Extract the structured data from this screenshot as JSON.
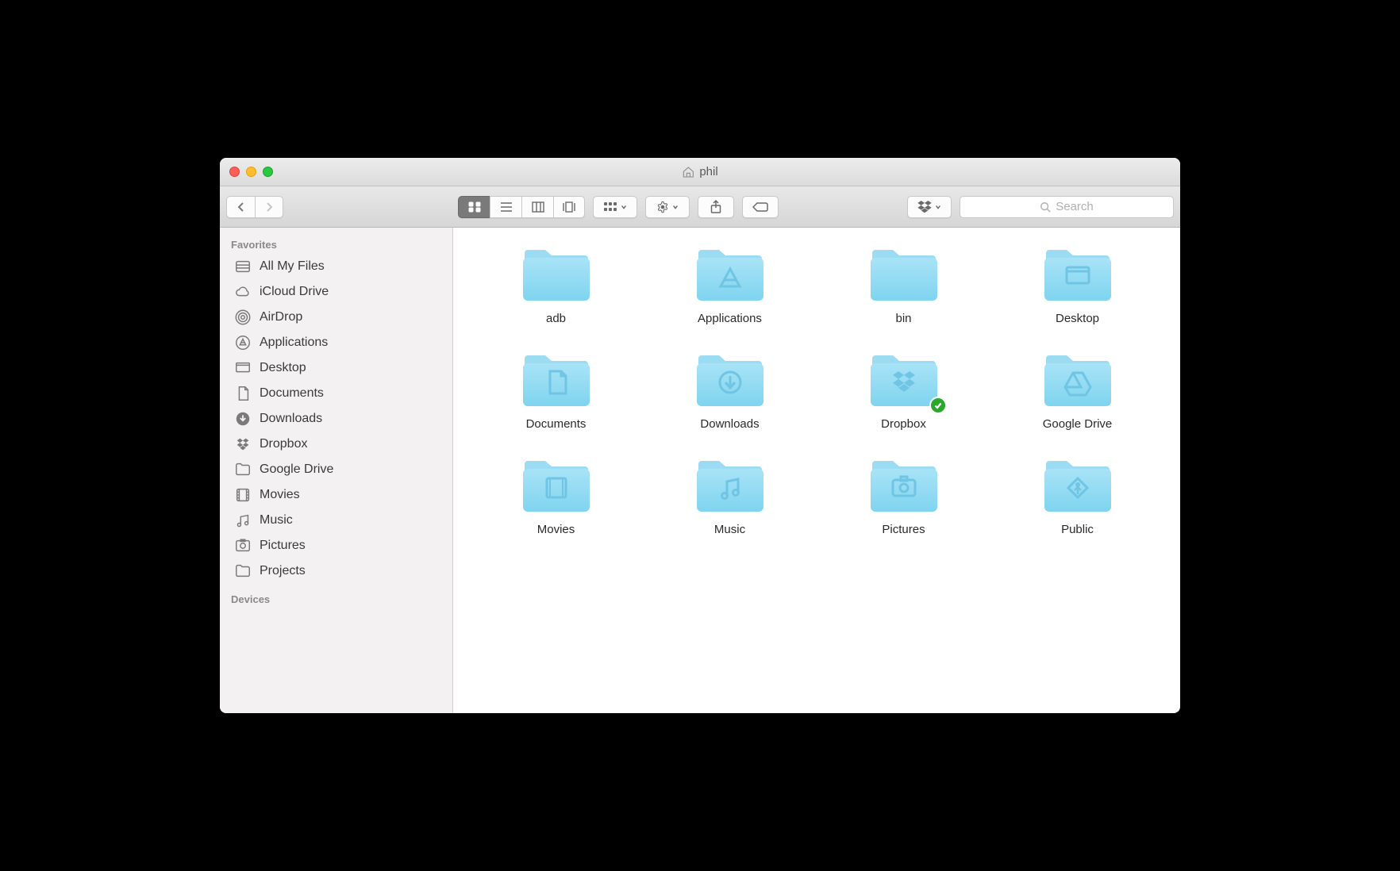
{
  "window": {
    "title": "phil"
  },
  "toolbar": {
    "search_placeholder": "Search"
  },
  "sidebar": {
    "sections": {
      "favorites_header": "Favorites",
      "devices_header": "Devices"
    },
    "favorites": [
      {
        "label": "All My Files",
        "icon": "all-my-files"
      },
      {
        "label": "iCloud Drive",
        "icon": "cloud"
      },
      {
        "label": "AirDrop",
        "icon": "airdrop"
      },
      {
        "label": "Applications",
        "icon": "applications"
      },
      {
        "label": "Desktop",
        "icon": "desktop"
      },
      {
        "label": "Documents",
        "icon": "documents"
      },
      {
        "label": "Downloads",
        "icon": "downloads"
      },
      {
        "label": "Dropbox",
        "icon": "dropbox"
      },
      {
        "label": "Google Drive",
        "icon": "folder"
      },
      {
        "label": "Movies",
        "icon": "movies"
      },
      {
        "label": "Music",
        "icon": "music"
      },
      {
        "label": "Pictures",
        "icon": "pictures"
      },
      {
        "label": "Projects",
        "icon": "folder"
      }
    ]
  },
  "content": {
    "items": [
      {
        "label": "adb",
        "glyph": "none"
      },
      {
        "label": "Applications",
        "glyph": "applications"
      },
      {
        "label": "bin",
        "glyph": "none"
      },
      {
        "label": "Desktop",
        "glyph": "desktop"
      },
      {
        "label": "Documents",
        "glyph": "documents"
      },
      {
        "label": "Downloads",
        "glyph": "downloads"
      },
      {
        "label": "Dropbox",
        "glyph": "dropbox",
        "synced": true
      },
      {
        "label": "Google Drive",
        "glyph": "gdrive"
      },
      {
        "label": "Movies",
        "glyph": "movies"
      },
      {
        "label": "Music",
        "glyph": "music"
      },
      {
        "label": "Pictures",
        "glyph": "pictures"
      },
      {
        "label": "Public",
        "glyph": "public"
      }
    ]
  }
}
